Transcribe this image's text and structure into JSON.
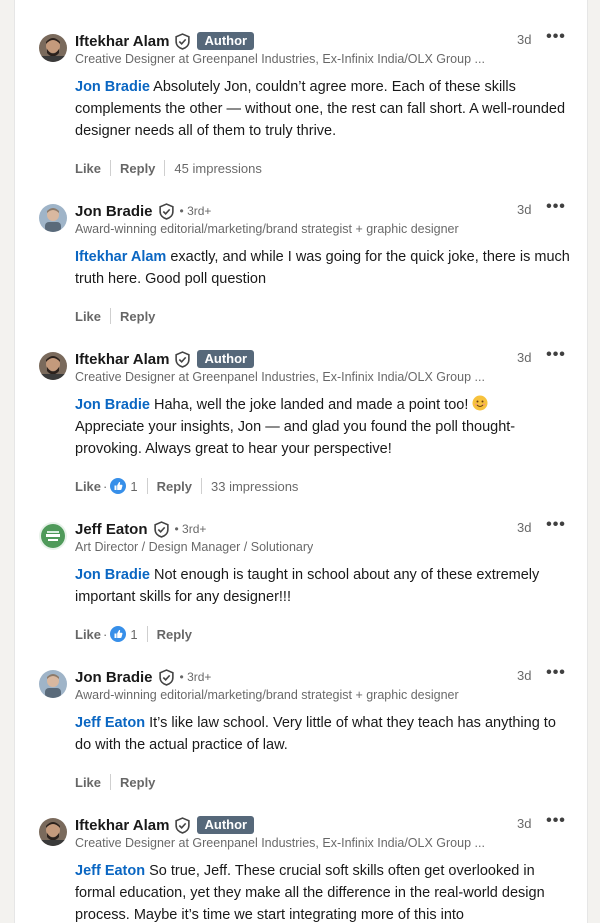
{
  "comments": [
    {
      "name": "Iftekhar Alam",
      "badge": "Author",
      "degree": "",
      "headline": "Creative Designer at Greenpanel Industries, Ex-Infinix India/OLX Group ...",
      "time": "3d",
      "mention": "Jon Bradie",
      "text": " Absolutely Jon, couldn’t agree more. Each of these skills complements the other — without one, the rest can fall short. A well-rounded designer needs all of them to truly thrive.",
      "like_label": "Like",
      "reply_label": "Reply",
      "reactions": "",
      "impressions": "45 impressions"
    },
    {
      "name": "Jon Bradie",
      "badge": "",
      "degree": "• 3rd+",
      "headline": "Award-winning editorial/marketing/brand strategist + graphic designer",
      "time": "3d",
      "mention": "Iftekhar Alam",
      "text": " exactly, and while I was going for the quick joke, there is much truth here. Good poll question",
      "like_label": "Like",
      "reply_label": "Reply",
      "reactions": "",
      "impressions": ""
    },
    {
      "name": "Iftekhar Alam",
      "badge": "Author",
      "degree": "",
      "headline": "Creative Designer at Greenpanel Industries, Ex-Infinix India/OLX Group ...",
      "time": "3d",
      "mention": "Jon Bradie",
      "text": " Haha, well the joke landed and made a point too! ",
      "text2": "Appreciate your insights, Jon — and glad you found the poll thought-provoking. Always great to hear your perspective!",
      "like_label": "Like",
      "reply_label": "Reply",
      "reactions": "1",
      "impressions": "33 impressions"
    },
    {
      "name": "Jeff Eaton",
      "badge": "",
      "degree": "• 3rd+",
      "headline": "Art Director / Design Manager / Solutionary",
      "time": "3d",
      "mention": "Jon Bradie",
      "text": " Not enough is taught in school about any of these extremely important skills for any designer!!!",
      "like_label": "Like",
      "reply_label": "Reply",
      "reactions": "1",
      "impressions": ""
    },
    {
      "name": "Jon Bradie",
      "badge": "",
      "degree": "• 3rd+",
      "headline": "Award-winning editorial/marketing/brand strategist + graphic designer",
      "time": "3d",
      "mention": "Jeff Eaton",
      "text": " It’s like law school. Very little of what they teach has anything to do with the actual practice of law.",
      "like_label": "Like",
      "reply_label": "Reply",
      "reactions": "",
      "impressions": ""
    },
    {
      "name": "Iftekhar Alam",
      "badge": "Author",
      "degree": "",
      "headline": "Creative Designer at Greenpanel Industries, Ex-Infinix India/OLX Group ...",
      "time": "3d",
      "mention": "Jeff Eaton",
      "text": " So true, Jeff. These crucial soft skills often get overlooked in formal education, yet they make all the difference in the real-world design process. Maybe it’s time we start integrating more of this into",
      "like_label": "",
      "reply_label": "",
      "reactions": "",
      "impressions": ""
    }
  ],
  "colors": {
    "mention": "#0a66c2",
    "author_badge": "#56687a",
    "like_reaction": "#378fe9"
  },
  "icons": {
    "verified": "shield-check-icon",
    "more": "more-horizontal-icon",
    "reaction": "like-reaction-icon",
    "emoji": "smiling-face-emoji"
  }
}
